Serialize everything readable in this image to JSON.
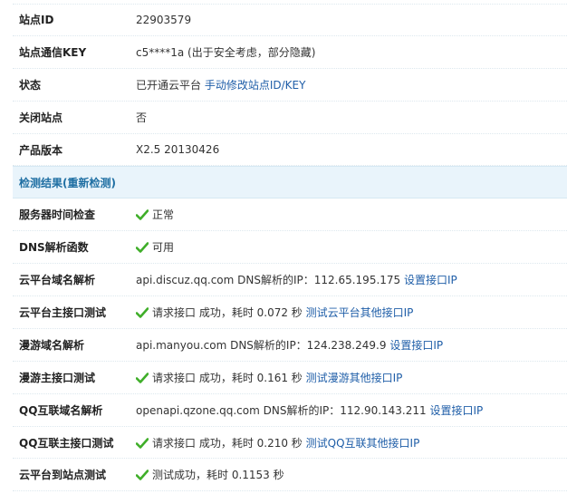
{
  "colors": {
    "link": "#1f5ea8",
    "section_bg": "#e9f4fb",
    "section_text": "#1f6fa3",
    "check_green": "#3fae29"
  },
  "rows_top": [
    {
      "label": "站点ID",
      "value": "22903579"
    },
    {
      "label": "站点通信KEY",
      "value": "c5****1a (出于安全考虑，部分隐藏)"
    },
    {
      "label": "状态",
      "value": "已开通云平台",
      "link": "手动修改站点ID/KEY"
    },
    {
      "label": "关闭站点",
      "value": "否"
    },
    {
      "label": "产品版本",
      "value": "X2.5 20130426"
    }
  ],
  "section": {
    "title": "检测结果",
    "recheck_link": "重新检测",
    "open_paren": "(",
    "close_paren": ")"
  },
  "checks": {
    "server_time": {
      "label": "服务器时间检查",
      "icon": "check-icon",
      "value": "正常"
    },
    "dns_func": {
      "label": "DNS解析函数",
      "icon": "check-icon",
      "value": "可用"
    },
    "cloud_dns": {
      "label": "云平台域名解析",
      "value": "api.discuz.qq.com DNS解析的IP：112.65.195.175",
      "link": "设置接口IP"
    },
    "cloud_api": {
      "label": "云平台主接口测试",
      "icon": "check-icon",
      "value": "请求接口 成功，耗时 0.072 秒",
      "link": "测试云平台其他接口IP"
    },
    "manyou_dns": {
      "label": "漫游域名解析",
      "value": "api.manyou.com DNS解析的IP：124.238.249.9",
      "link": "设置接口IP"
    },
    "manyou_api": {
      "label": "漫游主接口测试",
      "icon": "check-icon",
      "value": "请求接口 成功，耗时 0.161 秒",
      "link": "测试漫游其他接口IP"
    },
    "qq_dns": {
      "label": "QQ互联域名解析",
      "value": "openapi.qzone.qq.com DNS解析的IP：112.90.143.211",
      "link": "设置接口IP"
    },
    "qq_api": {
      "label": "QQ互联主接口测试",
      "icon": "check-icon",
      "value": "请求接口 成功，耗时 0.210 秒",
      "link": "测试QQ互联其他接口IP"
    },
    "cloud_to_site": {
      "label": "云平台到站点测试",
      "icon": "check-icon",
      "value": "测试成功，耗时 0.1153 秒"
    }
  }
}
